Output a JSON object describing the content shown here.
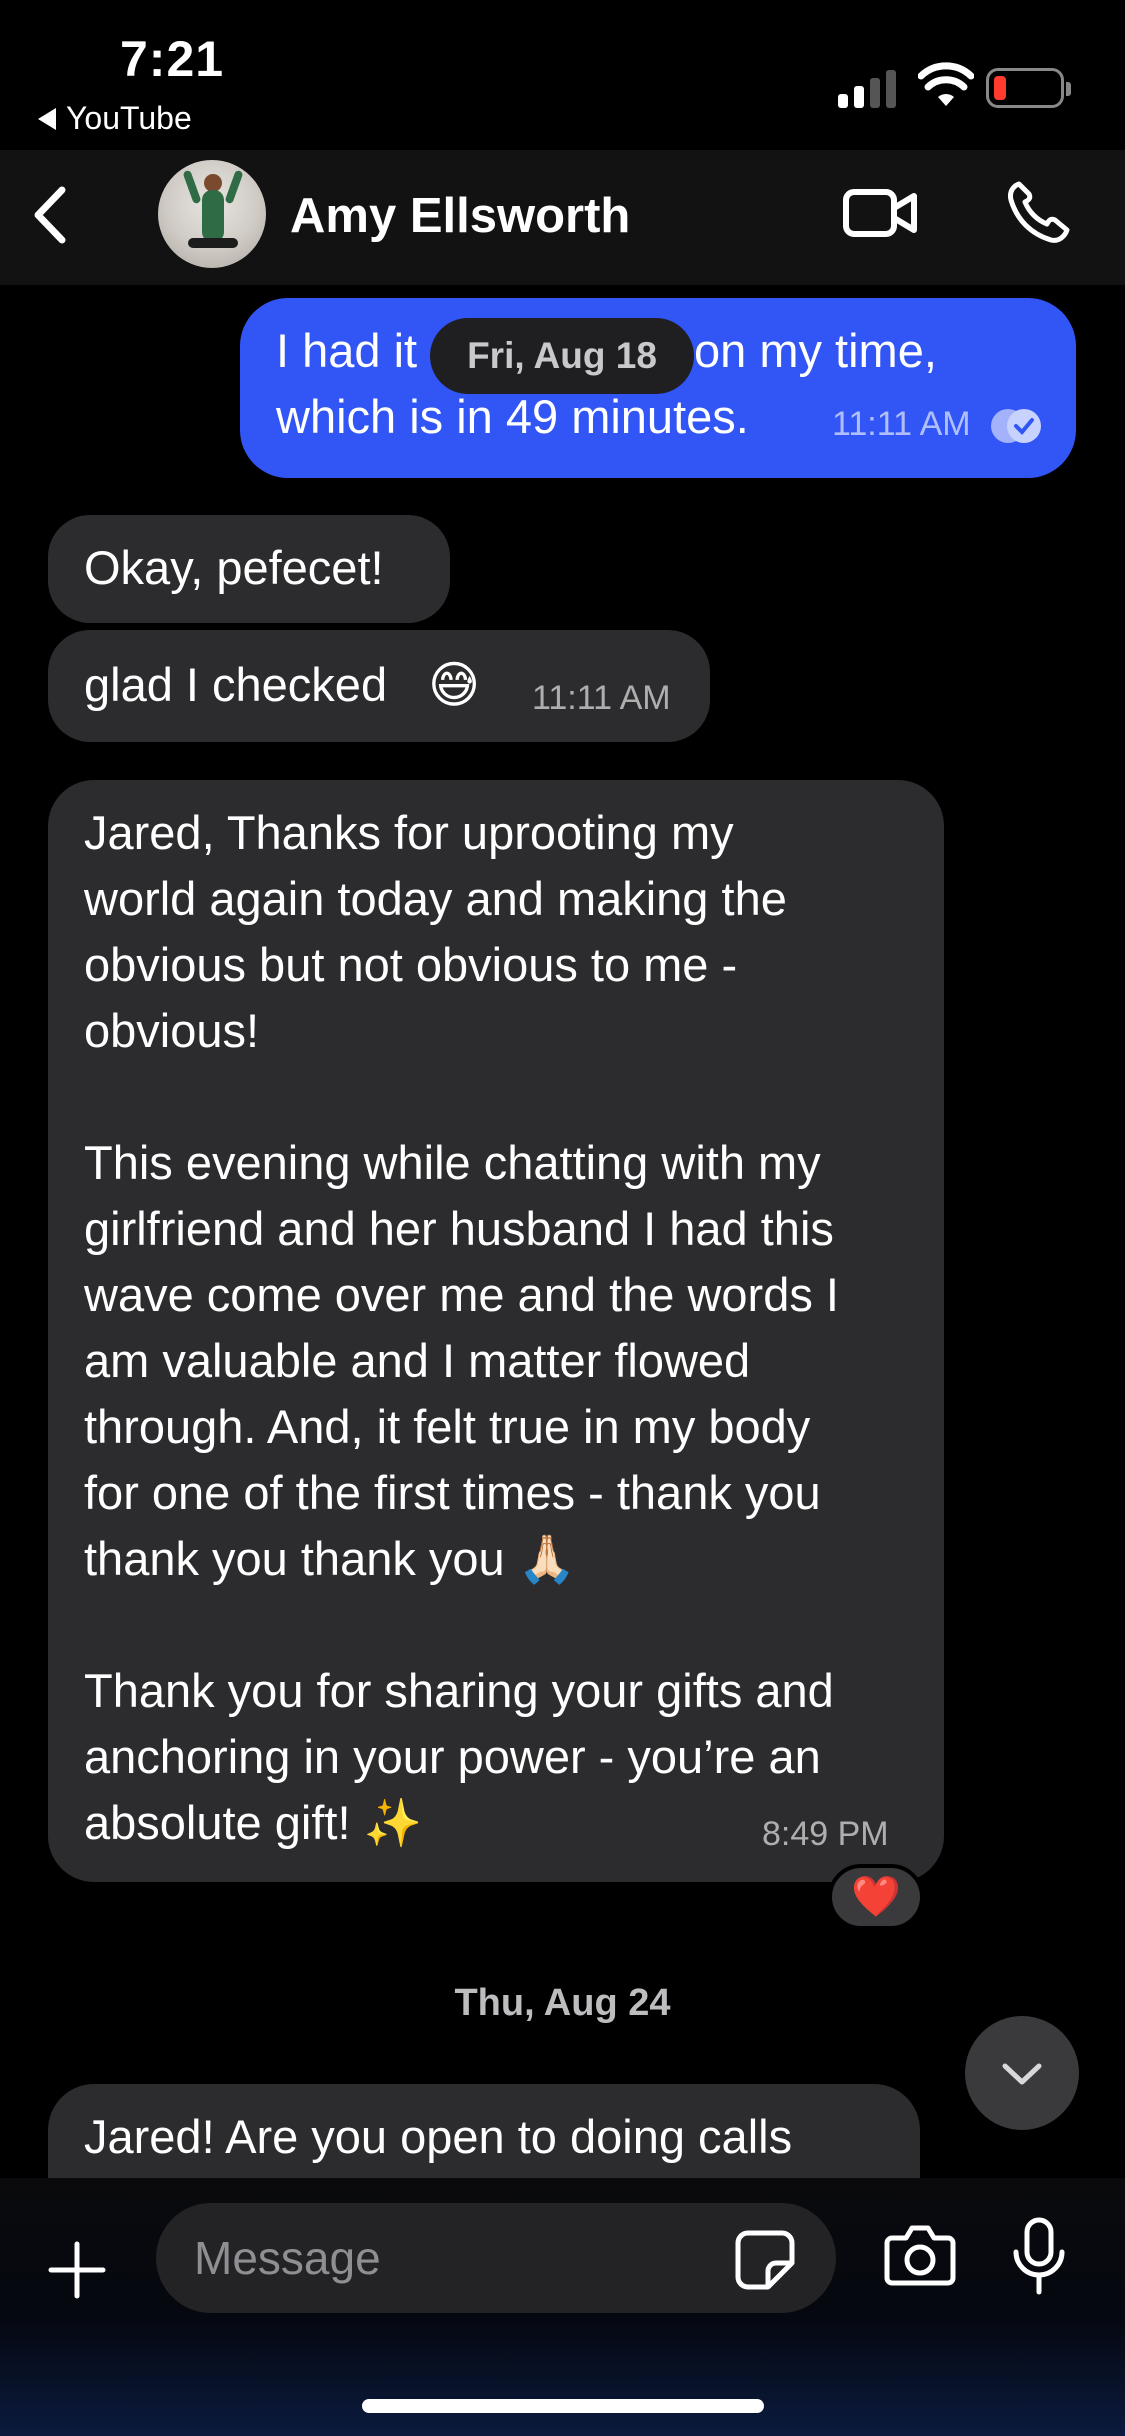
{
  "status_bar": {
    "time": "7:21",
    "back_app": "YouTube"
  },
  "header": {
    "contact_name": "Amy Ellsworth",
    "icons": [
      "chevron-left-icon",
      "video-camera-icon",
      "phone-icon"
    ]
  },
  "floating_date": "Fri, Aug 18",
  "messages": [
    {
      "direction": "outgoing",
      "line1": "I had it",
      "line1_end": "on my time,",
      "line2": "which is in 49 minutes.",
      "time": "11:11 AM",
      "status": "seen"
    },
    {
      "direction": "incoming",
      "text": "Okay, pefecet!"
    },
    {
      "direction": "incoming",
      "text": "glad I checked",
      "emoji": "😅",
      "time": "11:11 AM"
    },
    {
      "direction": "incoming",
      "lines": [
        "Jared, Thanks for uprooting my",
        "world again today and making the",
        "obvious but not obvious to me -",
        "obvious!",
        "",
        "This evening while chatting with my",
        "girlfriend and her husband I had this",
        "wave come over me and the words I",
        "am valuable and I matter flowed",
        "through. And, it felt true in my body",
        "for one of the first times - thank you",
        "thank you thank you 🙏🏻",
        "",
        "Thank you for sharing your gifts and",
        "anchoring in your power - you’re an",
        "absolute gift! ✨"
      ],
      "time": "8:49 PM",
      "reaction": "❤️"
    },
    {
      "direction": "incoming",
      "text": "Jared! Are you open to doing calls"
    }
  ],
  "date_separator": "Thu, Aug 24",
  "composer": {
    "placeholder": "Message"
  },
  "colors": {
    "outgoing_bubble": "#3156f5",
    "incoming_bubble": "#2c2c2e",
    "background": "#000000"
  }
}
